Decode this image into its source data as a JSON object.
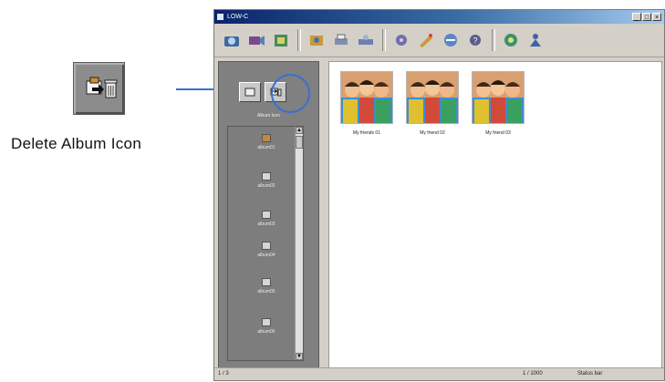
{
  "callout": {
    "label": "Delete Album Icon",
    "icon": "delete-album-icon"
  },
  "window": {
    "title": "LOW-C",
    "controls": [
      "_",
      "□",
      "×"
    ],
    "toolbar_icons": [
      "camera-icon",
      "camcorder-icon",
      "album-icon",
      "photo-edit-icon",
      "print-icon",
      "scanner-icon",
      "settings-icon",
      "effects-icon",
      "email-icon",
      "help-icon",
      "music-icon",
      "user-icon"
    ]
  },
  "album_pane": {
    "tools": [
      "new-album-icon",
      "delete-album-icon"
    ],
    "icon_caption": "Album Icon",
    "albums": [
      "album01",
      "album02",
      "album03",
      "album04",
      "album05",
      "album06"
    ]
  },
  "thumbnails": [
    {
      "caption": "My friends 01"
    },
    {
      "caption": "My friend 02"
    },
    {
      "caption": "My friend 03"
    }
  ],
  "status": {
    "left": "1 / 3",
    "middle": "1 / 1000",
    "right": "Status bar"
  },
  "colors": {
    "callout_line": "#3a6fd0",
    "titlebar": "#0a246a"
  }
}
